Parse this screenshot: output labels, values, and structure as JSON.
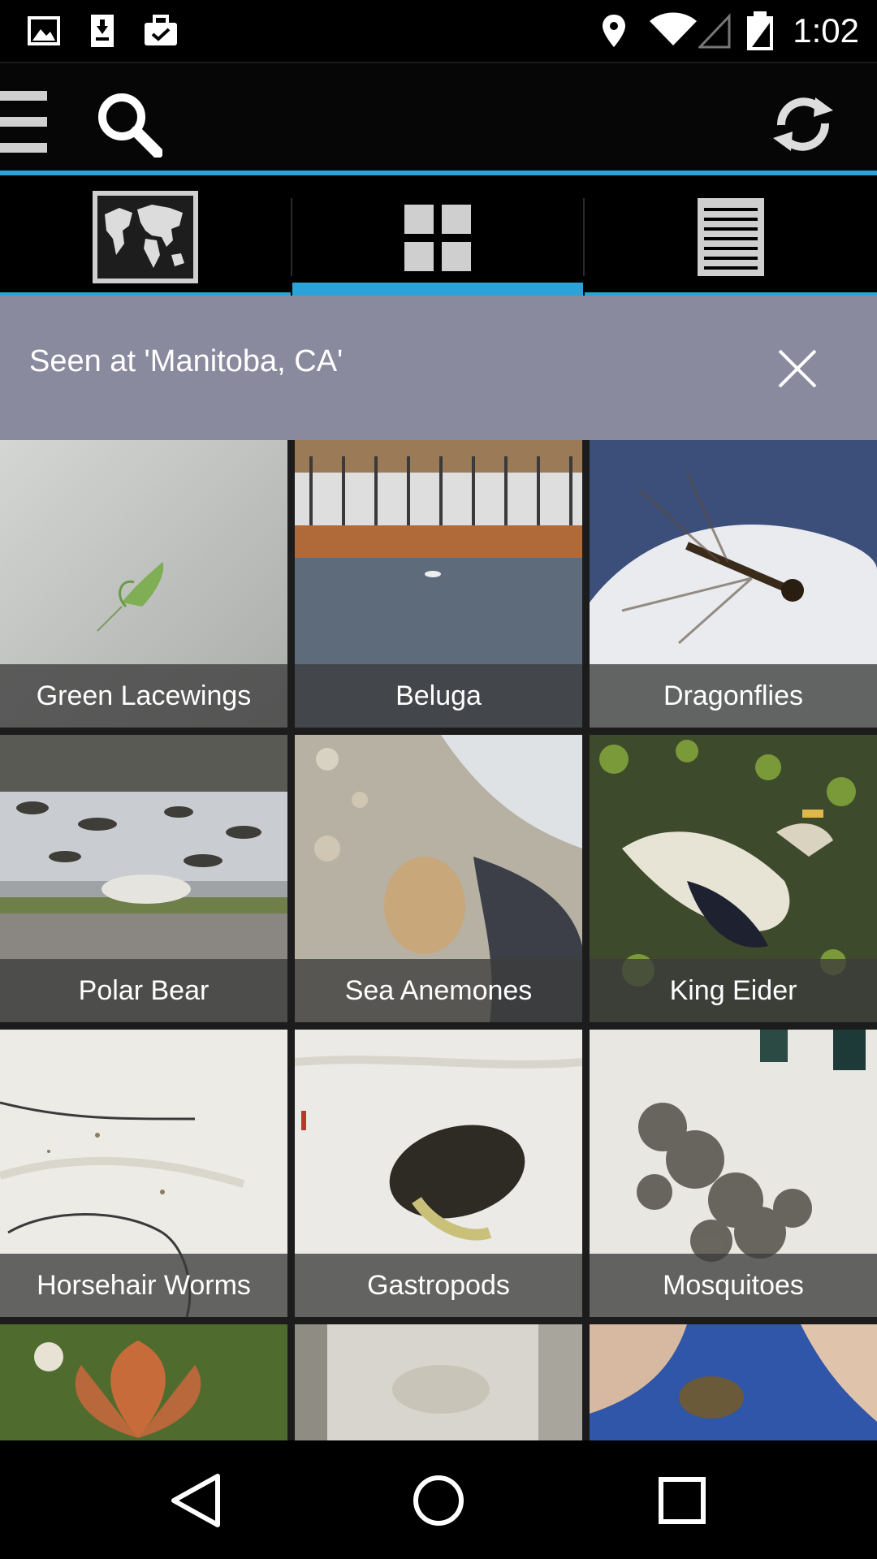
{
  "status_bar": {
    "time": "1:02",
    "left_icons": [
      "image-icon",
      "download-icon",
      "briefcase-check-icon"
    ],
    "right_icons": [
      "location-icon",
      "wifi-icon",
      "signal-icon",
      "battery-icon"
    ]
  },
  "action_bar": {
    "accent_color": "#2aa3d8",
    "icons": [
      "menu-icon",
      "search-icon",
      "refresh-icon"
    ]
  },
  "tabs": [
    {
      "name": "map",
      "icon": "world-map-icon",
      "selected": false
    },
    {
      "name": "grid",
      "icon": "grid-icon",
      "selected": true
    },
    {
      "name": "list",
      "icon": "list-icon",
      "selected": false
    }
  ],
  "filter": {
    "text": "Seen at 'Manitoba, CA'",
    "background": "#8a8a9f"
  },
  "grid": {
    "items": [
      {
        "label": "Green Lacewings"
      },
      {
        "label": "Beluga"
      },
      {
        "label": "Dragonflies"
      },
      {
        "label": "Polar Bear"
      },
      {
        "label": "Sea Anemones"
      },
      {
        "label": "King Eider"
      },
      {
        "label": "Horsehair Worms"
      },
      {
        "label": "Gastropods"
      },
      {
        "label": "Mosquitoes"
      },
      {
        "label": ""
      },
      {
        "label": ""
      },
      {
        "label": ""
      }
    ]
  },
  "nav_bar": {
    "icons": [
      "back-icon",
      "home-icon",
      "recents-icon"
    ]
  }
}
